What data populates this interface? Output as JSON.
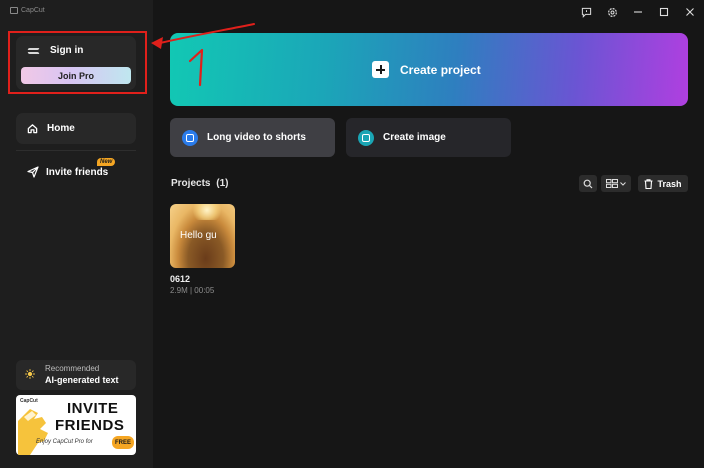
{
  "app": {
    "title": "CapCut"
  },
  "sidebar": {
    "sign_in_label": "Sign in",
    "join_pro_label": "Join Pro",
    "nav": [
      {
        "label": "Home",
        "icon": "home-icon",
        "active": true
      },
      {
        "label": "Invite friends",
        "icon": "send-icon",
        "badge": "New"
      }
    ],
    "recommended": {
      "label": "Recommended",
      "title": "AI-generated text",
      "icon": "lightbulb-icon"
    },
    "invite_banner": {
      "brand": "CapCut",
      "line1": "INVITE",
      "line2": "FRIENDS",
      "subtitle": "Enjoy CapCut Pro for",
      "badge": "FREE"
    }
  },
  "main": {
    "create_project_label": "Create project",
    "quick_actions": [
      {
        "label": "Long video to shorts",
        "icon": "shorts-icon"
      },
      {
        "label": "Create image",
        "icon": "image-icon"
      }
    ],
    "projects": {
      "title": "Projects",
      "count": "(1)",
      "trash_label": "Trash",
      "items": [
        {
          "name": "0612",
          "size": "2.9M",
          "duration": "00:05",
          "meta": "2.9M | 00:05",
          "thumbnail_caption": "Hello gu"
        }
      ]
    }
  },
  "annotations": {
    "step_number": "1",
    "color": "#e0201b"
  },
  "colors": {
    "background": "#161616",
    "sidebar": "#1e1e1e",
    "card": "#282828",
    "accent_blue": "#2a7bea",
    "accent_teal": "#1aa5b4",
    "badge_orange": "#f5a623"
  }
}
